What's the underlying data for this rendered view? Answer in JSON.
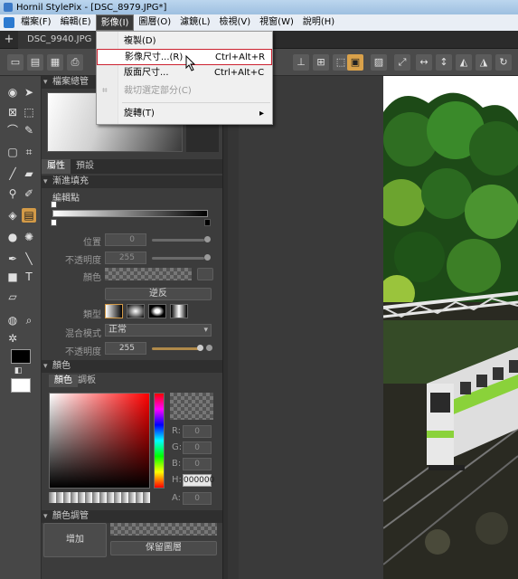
{
  "window": {
    "title": "Hornil StylePix - [DSC_8979.JPG*]"
  },
  "menubar": {
    "items": [
      "檔案(F)",
      "編輯(E)",
      "影像(I)",
      "圖層(O)",
      "濾鏡(L)",
      "檢視(V)",
      "視窗(W)",
      "說明(H)"
    ],
    "active_index": 2
  },
  "tabs": {
    "add": "+",
    "items": [
      "DSC_9940.JPG"
    ]
  },
  "image_menu": {
    "items": [
      {
        "label": "複製(D)",
        "shortcut": "",
        "state": "normal"
      },
      {
        "label": "影像尺寸...(R)",
        "shortcut": "Ctrl+Alt+R",
        "state": "highlighted"
      },
      {
        "label": "版面尺寸...",
        "shortcut": "Ctrl+Alt+C",
        "state": "normal"
      },
      {
        "label": "裁切選定部分(C)",
        "shortcut": "",
        "state": "disabled"
      },
      {
        "label": "旋轉(T)",
        "shortcut": "",
        "state": "submenu",
        "arrow": "▸"
      }
    ]
  },
  "panel": {
    "navigator_title": "檔案總管",
    "subtabs": [
      "屬性",
      "預設"
    ],
    "gradient": {
      "title": "漸進填充",
      "edit_points": "編輯點",
      "position_label": "位置",
      "position_value": "0",
      "opacity_label": "不透明度",
      "opacity_value": "255",
      "color_label": "顏色",
      "reverse_button": "逆反",
      "type_label": "類型",
      "blend_label": "混合模式",
      "blend_value": "正常",
      "opacity2_label": "不透明度",
      "opacity2_value": "255"
    },
    "color": {
      "title": "顏色",
      "tabs": [
        "顏色",
        "調板"
      ],
      "r_label": "R:",
      "r_value": "0",
      "g_label": "G:",
      "g_value": "0",
      "b_label": "B:",
      "b_value": "0",
      "h_label": "H:",
      "h_value": "000000",
      "a_label": "A:",
      "a_value": "0"
    },
    "swatches": {
      "title": "顏色調管",
      "add_button": "增加",
      "keep_button": "保留圖層"
    }
  },
  "colors": {
    "accent": "#d39a47",
    "highlight_border": "#cc2230",
    "foreground": "#000000",
    "background": "#ffffff"
  }
}
